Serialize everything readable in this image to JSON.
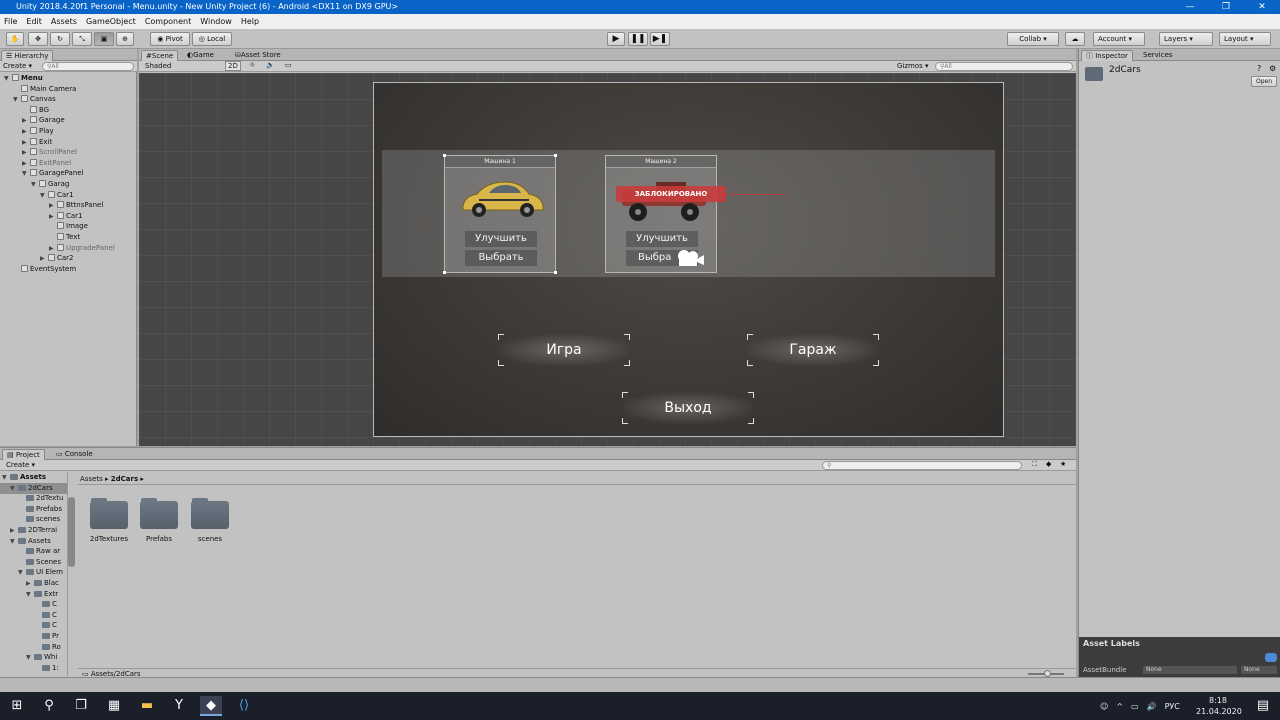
{
  "window": {
    "title": "Unity 2018.4.20f1 Personal - Menu.unity - New Unity Project (6) - Android <DX11 on DX9 GPU>"
  },
  "menu": [
    "File",
    "Edit",
    "Assets",
    "GameObject",
    "Component",
    "Window",
    "Help"
  ],
  "toolbar": {
    "pivot": "Pivot",
    "local": "Local",
    "collab": "Collab ▾",
    "account": "Account",
    "layers": "Layers",
    "layout": "Layout"
  },
  "hierarchy": {
    "tab": "Hierarchy",
    "create": "Create ▾",
    "search": "All",
    "items": [
      {
        "label": "Menu",
        "depth": 0,
        "bold": true,
        "dim": false,
        "tri": "▼"
      },
      {
        "label": "Main Camera",
        "depth": 1,
        "dim": false,
        "tri": ""
      },
      {
        "label": "Canvas",
        "depth": 1,
        "dim": false,
        "tri": "▼"
      },
      {
        "label": "BG",
        "depth": 2,
        "dim": false,
        "tri": ""
      },
      {
        "label": "Garage",
        "depth": 2,
        "dim": false,
        "tri": "▶"
      },
      {
        "label": "Play",
        "depth": 2,
        "dim": false,
        "tri": "▶"
      },
      {
        "label": "Exit",
        "depth": 2,
        "dim": false,
        "tri": "▶"
      },
      {
        "label": "ScrollPanel",
        "depth": 2,
        "dim": true,
        "tri": "▶"
      },
      {
        "label": "ExitPanel",
        "depth": 2,
        "dim": true,
        "tri": "▶"
      },
      {
        "label": "GaragePanel",
        "depth": 2,
        "dim": false,
        "tri": "▼"
      },
      {
        "label": "Garag",
        "depth": 3,
        "dim": false,
        "tri": "▼"
      },
      {
        "label": "Car1",
        "depth": 4,
        "dim": false,
        "tri": "▼"
      },
      {
        "label": "BttnsPanel",
        "depth": 5,
        "dim": false,
        "tri": "▶"
      },
      {
        "label": "Car1",
        "depth": 5,
        "dim": false,
        "tri": "▶"
      },
      {
        "label": "Image",
        "depth": 5,
        "dim": false,
        "tri": ""
      },
      {
        "label": "Text",
        "depth": 5,
        "dim": false,
        "tri": ""
      },
      {
        "label": "UpgradePanel",
        "depth": 5,
        "dim": true,
        "tri": "▶"
      },
      {
        "label": "Car2",
        "depth": 4,
        "dim": false,
        "tri": "▶"
      },
      {
        "label": "EventSystem",
        "depth": 1,
        "dim": false,
        "tri": ""
      }
    ]
  },
  "scene_tabs": [
    "Scene",
    "Game",
    "Asset Store"
  ],
  "scene_bar": {
    "shading": "Shaded",
    "mode2d": "2D",
    "gizmos": "Gizmos ▾",
    "search": "All"
  },
  "game_ui": {
    "car1": {
      "title": "Машина 1",
      "upgrade": "Улучшить",
      "select": "Выбрать"
    },
    "car2": {
      "title": "Машина 2",
      "locked": "ЗАБЛОКИРОВАНО",
      "upgrade": "Улучшить",
      "select": "Выбра"
    },
    "play": "Игра",
    "garage": "Гараж",
    "exit": "Выход"
  },
  "inspector": {
    "tabs": [
      "Inspector",
      "Services"
    ],
    "name": "2dCars",
    "open": "Open",
    "asset_labels": "Asset Labels",
    "asset_bundle": "AssetBundle",
    "none1": "None",
    "none2": "None"
  },
  "project": {
    "tabs": [
      "Project",
      "Console"
    ],
    "create": "Create ▾",
    "breadcrumb": [
      "Assets",
      "2dCars"
    ],
    "tree": [
      {
        "label": "Assets",
        "depth": 0,
        "bold": true,
        "tri": "▼"
      },
      {
        "label": "2dCars",
        "depth": 1,
        "tri": "▼",
        "selected": true
      },
      {
        "label": "2dTextu",
        "depth": 2,
        "tri": ""
      },
      {
        "label": "Prefabs",
        "depth": 2,
        "tri": ""
      },
      {
        "label": "scenes",
        "depth": 2,
        "tri": ""
      },
      {
        "label": "2DTerrai",
        "depth": 1,
        "tri": "▶"
      },
      {
        "label": "Assets",
        "depth": 1,
        "tri": "▼"
      },
      {
        "label": "Raw ar",
        "depth": 2,
        "tri": ""
      },
      {
        "label": "Scenes",
        "depth": 2,
        "tri": ""
      },
      {
        "label": "UI Elem",
        "depth": 2,
        "tri": "▼"
      },
      {
        "label": "Blac",
        "depth": 3,
        "tri": "▶"
      },
      {
        "label": "Extr",
        "depth": 3,
        "tri": "▼"
      },
      {
        "label": "C",
        "depth": 4,
        "tri": ""
      },
      {
        "label": "C",
        "depth": 4,
        "tri": ""
      },
      {
        "label": "C",
        "depth": 4,
        "tri": ""
      },
      {
        "label": "Pr",
        "depth": 4,
        "tri": ""
      },
      {
        "label": "Ro",
        "depth": 4,
        "tri": ""
      },
      {
        "label": "Whi",
        "depth": 3,
        "tri": "▼"
      },
      {
        "label": "1:",
        "depth": 4,
        "tri": ""
      }
    ],
    "folders": [
      "2dTextures",
      "Prefabs",
      "scenes"
    ],
    "footer_path": "Assets/2dCars"
  },
  "taskbar": {
    "time": "8:18",
    "date": "21.04.2020",
    "lang": "РУС"
  }
}
